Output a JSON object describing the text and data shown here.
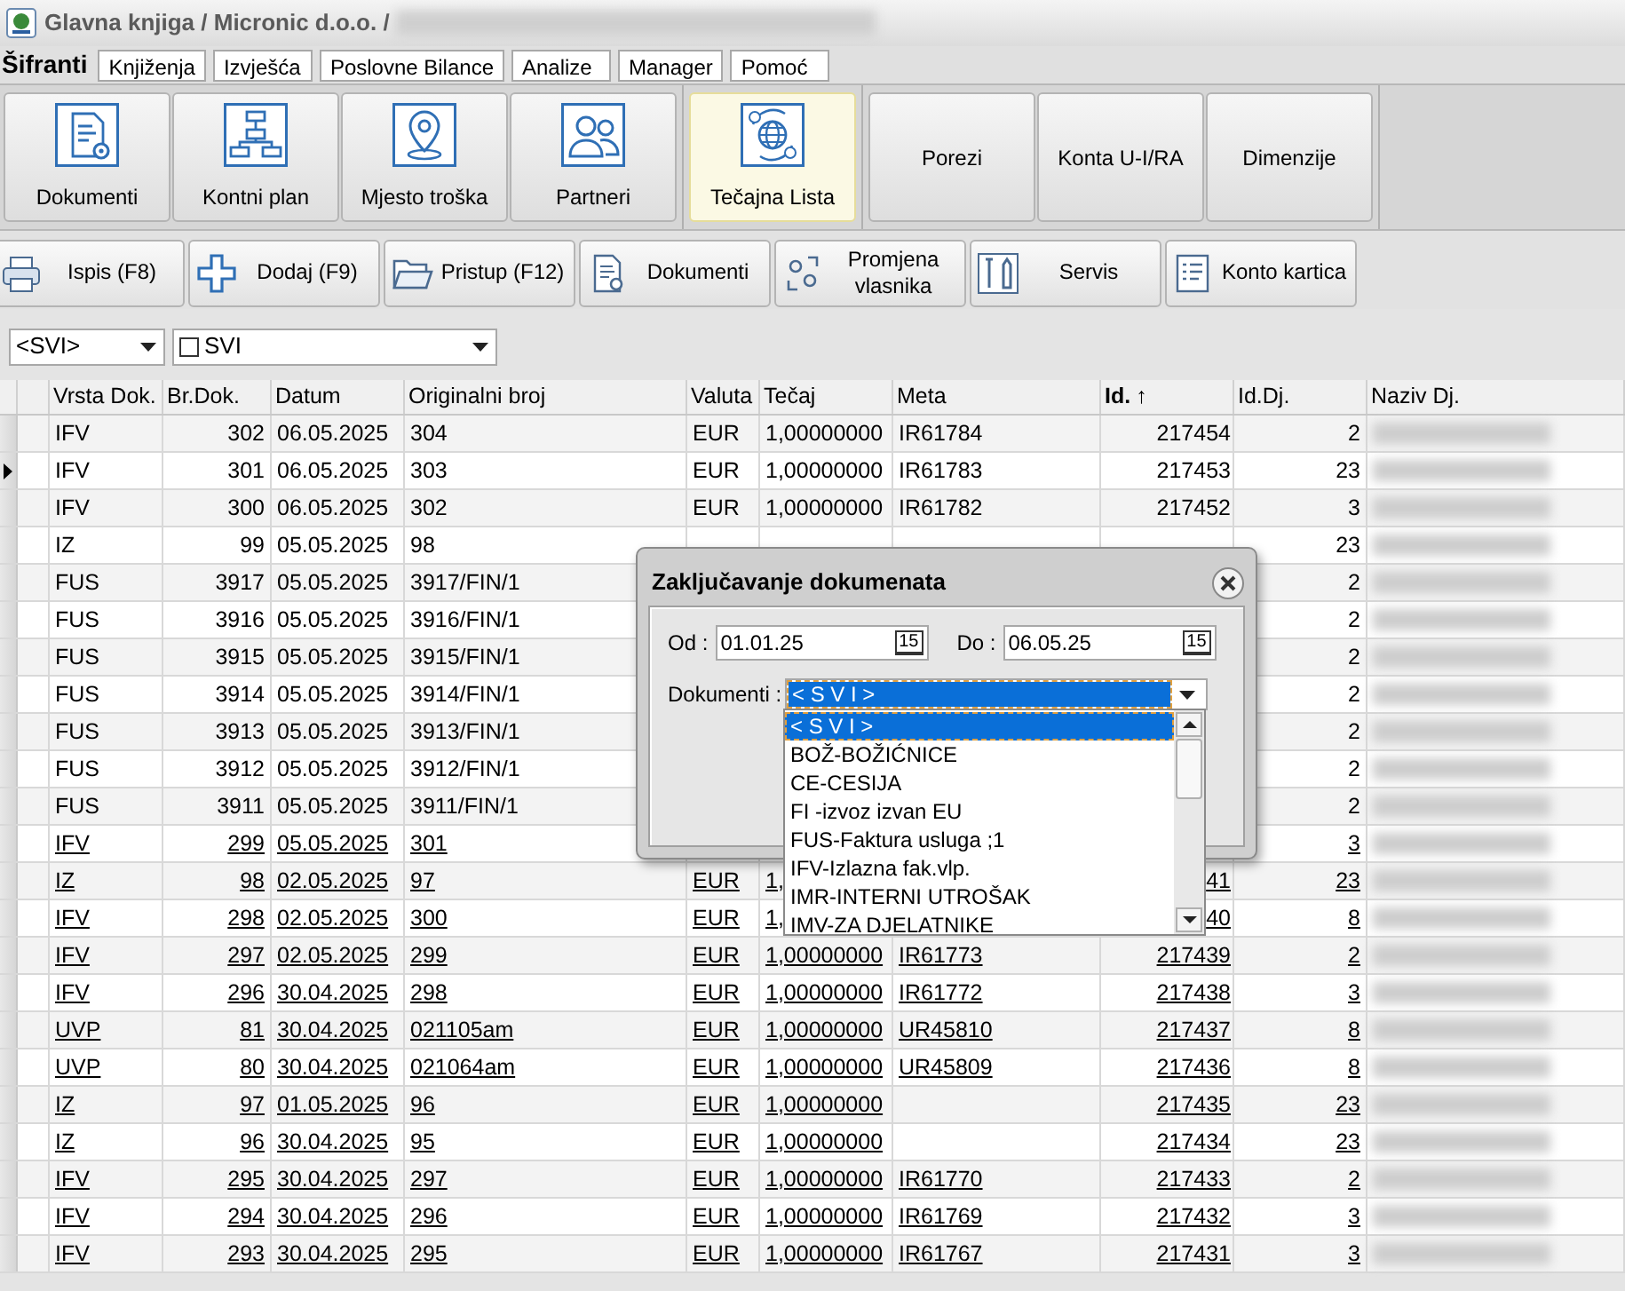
{
  "window": {
    "title": "Glavna knjiga / Micronic d.o.o. /"
  },
  "tabs": [
    {
      "label": "Šifranti",
      "selected": true
    },
    {
      "label": "Knjiženja",
      "selected": false
    },
    {
      "label": "Izvješća",
      "selected": false
    },
    {
      "label": "Poslovne Bilance",
      "selected": false
    },
    {
      "label": "Analize",
      "selected": false
    },
    {
      "label": "Manager",
      "selected": false
    },
    {
      "label": "Pomoć",
      "selected": false
    }
  ],
  "ribbon": {
    "groups": [
      {
        "buttons": [
          {
            "label": "Dokumenti",
            "kind": "document",
            "selected": false
          },
          {
            "label": "Kontni plan",
            "kind": "orgchart",
            "selected": false
          },
          {
            "label": "Mjesto troška",
            "kind": "pin",
            "selected": false
          },
          {
            "label": "Partneri",
            "kind": "people",
            "selected": false
          }
        ]
      },
      {
        "buttons": [
          {
            "label": "Tečajna Lista",
            "kind": "globe",
            "selected": true
          }
        ]
      },
      {
        "buttons": [
          {
            "label": "Porezi",
            "kind": "text",
            "selected": false
          },
          {
            "label": "Konta U-I/RA",
            "kind": "text",
            "selected": false
          },
          {
            "label": "Dimenzije",
            "kind": "text",
            "selected": false
          }
        ]
      }
    ]
  },
  "toolbar": [
    {
      "label": "Ispis (F8)",
      "kind": "printer"
    },
    {
      "label": "Dodaj (F9)",
      "kind": "plus"
    },
    {
      "label": "Pristup (F12)",
      "kind": "folder"
    },
    {
      "label": "Dokumenti",
      "kind": "document"
    },
    {
      "label": "Promjena vlasnika",
      "kind": "swap"
    },
    {
      "label": "Servis",
      "kind": "tools"
    },
    {
      "label": "Konto kartica",
      "kind": "form"
    }
  ],
  "filters": {
    "type_combo": {
      "value": "<SVI>"
    },
    "company_combo": {
      "value": "SVI",
      "checked": false
    }
  },
  "table": {
    "columns": [
      {
        "label": "Vrsta Dok.",
        "sorted": false
      },
      {
        "label": "Br.Dok.",
        "sorted": false
      },
      {
        "label": "Datum",
        "sorted": false
      },
      {
        "label": "Originalni broj",
        "sorted": false
      },
      {
        "label": "Valuta",
        "sorted": false
      },
      {
        "label": "Tečaj",
        "sorted": false
      },
      {
        "label": "Meta",
        "sorted": false
      },
      {
        "label": "Id.",
        "sorted": true,
        "sort_mark": "↑"
      },
      {
        "label": "Id.Dj.",
        "sorted": false
      },
      {
        "label": "Naziv Dj.",
        "sorted": false
      }
    ],
    "rows": [
      {
        "current": false,
        "underlined": false,
        "cells": {
          "vrsta": "IFV",
          "br": "302",
          "datum": "06.05.2025",
          "orig": "304",
          "valuta": "EUR",
          "tecaj": "1,00000000",
          "meta": "IR61784",
          "id": "217454",
          "iddj": "2"
        }
      },
      {
        "current": true,
        "underlined": false,
        "cells": {
          "vrsta": "IFV",
          "br": "301",
          "datum": "06.05.2025",
          "orig": "303",
          "valuta": "EUR",
          "tecaj": "1,00000000",
          "meta": "IR61783",
          "id": "217453",
          "iddj": "23"
        }
      },
      {
        "current": false,
        "underlined": false,
        "cells": {
          "vrsta": "IFV",
          "br": "300",
          "datum": "06.05.2025",
          "orig": "302",
          "valuta": "EUR",
          "tecaj": "1,00000000",
          "meta": "IR61782",
          "id": "217452",
          "iddj": "3"
        }
      },
      {
        "current": false,
        "underlined": false,
        "cells": {
          "vrsta": "IZ",
          "br": "99",
          "datum": "05.05.2025",
          "orig": "98",
          "iddj": "23"
        }
      },
      {
        "current": false,
        "underlined": false,
        "cells": {
          "vrsta": "FUS",
          "br": "3917",
          "datum": "05.05.2025",
          "orig": "3917/FIN/1",
          "iddj": "2"
        }
      },
      {
        "current": false,
        "underlined": false,
        "cells": {
          "vrsta": "FUS",
          "br": "3916",
          "datum": "05.05.2025",
          "orig": "3916/FIN/1",
          "iddj": "2"
        }
      },
      {
        "current": false,
        "underlined": false,
        "cells": {
          "vrsta": "FUS",
          "br": "3915",
          "datum": "05.05.2025",
          "orig": "3915/FIN/1",
          "iddj": "2"
        }
      },
      {
        "current": false,
        "underlined": false,
        "cells": {
          "vrsta": "FUS",
          "br": "3914",
          "datum": "05.05.2025",
          "orig": "3914/FIN/1",
          "iddj": "2"
        }
      },
      {
        "current": false,
        "underlined": false,
        "cells": {
          "vrsta": "FUS",
          "br": "3913",
          "datum": "05.05.2025",
          "orig": "3913/FIN/1",
          "iddj": "2"
        }
      },
      {
        "current": false,
        "underlined": false,
        "cells": {
          "vrsta": "FUS",
          "br": "3912",
          "datum": "05.05.2025",
          "orig": "3912/FIN/1",
          "iddj": "2"
        }
      },
      {
        "current": false,
        "underlined": false,
        "cells": {
          "vrsta": "FUS",
          "br": "3911",
          "datum": "05.05.2025",
          "orig": "3911/FIN/1",
          "iddj": "2"
        }
      },
      {
        "current": false,
        "underlined": true,
        "cells": {
          "vrsta": "IFV",
          "br": "299",
          "datum": "05.05.2025",
          "orig": "301",
          "iddj": "3"
        }
      },
      {
        "current": false,
        "underlined": true,
        "cells": {
          "vrsta": "IZ",
          "br": "98",
          "datum": "02.05.2025",
          "orig": "97",
          "valuta": "EUR",
          "tecaj": "1,",
          "id": "41",
          "iddj": "23"
        }
      },
      {
        "current": false,
        "underlined": true,
        "cells": {
          "vrsta": "IFV",
          "br": "298",
          "datum": "02.05.2025",
          "orig": "300",
          "valuta": "EUR",
          "tecaj": "1,",
          "id": "40",
          "iddj": "8"
        }
      },
      {
        "current": false,
        "underlined": true,
        "cells": {
          "vrsta": "IFV",
          "br": "297",
          "datum": "02.05.2025",
          "orig": "299",
          "valuta": "EUR",
          "tecaj": "1,00000000",
          "meta": "IR61773",
          "id": "217439",
          "iddj": "2"
        }
      },
      {
        "current": false,
        "underlined": true,
        "cells": {
          "vrsta": "IFV",
          "br": "296",
          "datum": "30.04.2025",
          "orig": "298",
          "valuta": "EUR",
          "tecaj": "1,00000000",
          "meta": "IR61772",
          "id": "217438",
          "iddj": "3"
        }
      },
      {
        "current": false,
        "underlined": true,
        "cells": {
          "vrsta": "UVP",
          "br": "81",
          "datum": "30.04.2025",
          "orig": "021105am",
          "valuta": "EUR",
          "tecaj": "1,00000000",
          "meta": "UR45810",
          "id": "217437",
          "iddj": "8"
        }
      },
      {
        "current": false,
        "underlined": true,
        "cells": {
          "vrsta": "UVP",
          "br": "80",
          "datum": "30.04.2025",
          "orig": "021064am",
          "valuta": "EUR",
          "tecaj": "1,00000000",
          "meta": "UR45809",
          "id": "217436",
          "iddj": "8"
        }
      },
      {
        "current": false,
        "underlined": true,
        "cells": {
          "vrsta": "IZ",
          "br": "97",
          "datum": "01.05.2025",
          "orig": "96",
          "valuta": "EUR",
          "tecaj": "1,00000000",
          "id": "217435",
          "iddj": "23"
        }
      },
      {
        "current": false,
        "underlined": true,
        "cells": {
          "vrsta": "IZ",
          "br": "96",
          "datum": "30.04.2025",
          "orig": "95",
          "valuta": "EUR",
          "tecaj": "1,00000000",
          "id": "217434",
          "iddj": "23"
        }
      },
      {
        "current": false,
        "underlined": true,
        "cells": {
          "vrsta": "IFV",
          "br": "295",
          "datum": "30.04.2025",
          "orig": "297",
          "valuta": "EUR",
          "tecaj": "1,00000000",
          "meta": "IR61770",
          "id": "217433",
          "iddj": "2"
        }
      },
      {
        "current": false,
        "underlined": true,
        "cells": {
          "vrsta": "IFV",
          "br": "294",
          "datum": "30.04.2025",
          "orig": "296",
          "valuta": "EUR",
          "tecaj": "1,00000000",
          "meta": "IR61769",
          "id": "217432",
          "iddj": "3"
        }
      },
      {
        "current": false,
        "underlined": true,
        "cells": {
          "vrsta": "IFV",
          "br": "293",
          "datum": "30.04.2025",
          "orig": "295",
          "valuta": "EUR",
          "tecaj": "1,00000000",
          "meta": "IR61767",
          "id": "217431",
          "iddj": "3"
        }
      }
    ]
  },
  "lock_dialog": {
    "title": "Zaključavanje dokumenata",
    "date_fields": [
      {
        "label": "Od :",
        "value": "01.01.25",
        "calendar": "15"
      },
      {
        "label": "Do :",
        "value": "06.05.25",
        "calendar": "15"
      }
    ],
    "documents_label": "Dokumenti :",
    "documents_value": "< S V I >",
    "options": [
      {
        "label": "< S V I >",
        "selected": true
      },
      {
        "label": "BOŽ-BOŽIĆNICE",
        "selected": false
      },
      {
        "label": "CE-CESIJA",
        "selected": false
      },
      {
        "label": "FI -izvoz izvan EU",
        "selected": false
      },
      {
        "label": "FUS-Faktura usluga ;1",
        "selected": false
      },
      {
        "label": "IFV-Izlazna fak.vlp.",
        "selected": false
      },
      {
        "label": "IMR-INTERNI UTROŠAK",
        "selected": false
      },
      {
        "label": "IMV-ZA DJELATNIKE",
        "selected": false
      }
    ]
  }
}
